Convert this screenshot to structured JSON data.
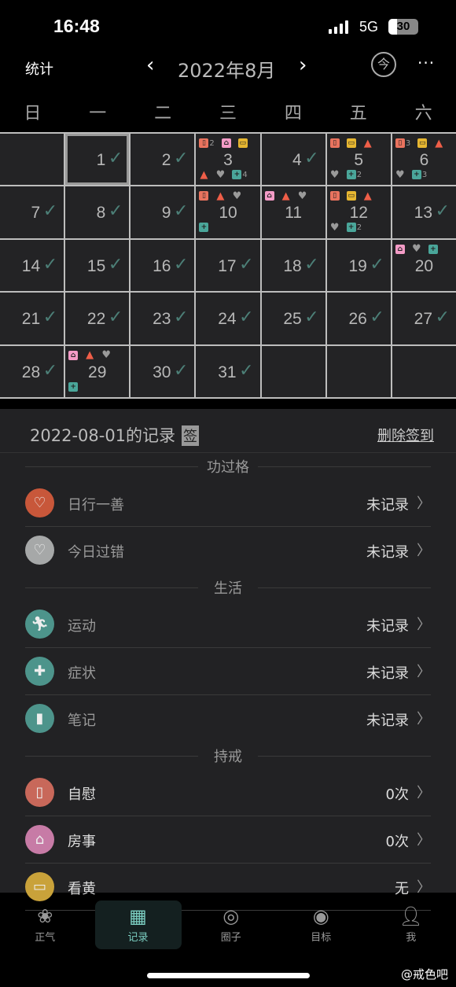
{
  "status": {
    "time": "16:48",
    "network": "5G",
    "battery": "30",
    "battery_level": 30
  },
  "nav": {
    "stats": "统计",
    "prev": "‹",
    "month": "2022年8月",
    "next": "›",
    "today": "今",
    "more": "···"
  },
  "weekdays": [
    "日",
    "一",
    "二",
    "三",
    "四",
    "五",
    "六"
  ],
  "icon_colors": {
    "tissue": "#e9735e",
    "house": "#f39bc6",
    "monitor": "#e6b631",
    "fire": "#ef5e48",
    "heart": "#9a9a9a",
    "medkit": "#4aa69a"
  },
  "calendar": {
    "leading_blank": 1,
    "trailing_blank": 3,
    "selected_day": 1,
    "days": [
      {
        "day": "1",
        "checked": true
      },
      {
        "day": "2",
        "checked": true
      },
      {
        "day": "3",
        "top": [
          {
            "icon": "tissue",
            "count": "2"
          },
          {
            "icon": "house"
          },
          {
            "icon": "monitor"
          }
        ],
        "bottom": [
          {
            "icon": "fire"
          },
          {
            "icon": "heart"
          },
          {
            "icon": "medkit",
            "count": "4"
          }
        ]
      },
      {
        "day": "4",
        "checked": true
      },
      {
        "day": "5",
        "top": [
          {
            "icon": "tissue"
          },
          {
            "icon": "monitor"
          },
          {
            "icon": "fire"
          }
        ],
        "bottom": [
          {
            "icon": "heart"
          },
          {
            "icon": "medkit",
            "count": "2"
          }
        ]
      },
      {
        "day": "6",
        "top": [
          {
            "icon": "tissue",
            "count": "3"
          },
          {
            "icon": "monitor"
          },
          {
            "icon": "fire"
          }
        ],
        "bottom": [
          {
            "icon": "heart"
          },
          {
            "icon": "medkit",
            "count": "3"
          }
        ]
      },
      {
        "day": "7",
        "checked": true
      },
      {
        "day": "8",
        "checked": true
      },
      {
        "day": "9",
        "checked": true
      },
      {
        "day": "10",
        "top": [
          {
            "icon": "tissue"
          },
          {
            "icon": "fire"
          },
          {
            "icon": "heart"
          }
        ],
        "bottom": [
          {
            "icon": "medkit"
          }
        ]
      },
      {
        "day": "11",
        "top": [
          {
            "icon": "house"
          },
          {
            "icon": "fire"
          },
          {
            "icon": "heart"
          }
        ]
      },
      {
        "day": "12",
        "top": [
          {
            "icon": "tissue"
          },
          {
            "icon": "monitor"
          },
          {
            "icon": "fire"
          }
        ],
        "bottom": [
          {
            "icon": "heart"
          },
          {
            "icon": "medkit",
            "count": "2"
          }
        ]
      },
      {
        "day": "13",
        "checked": true
      },
      {
        "day": "14",
        "checked": true
      },
      {
        "day": "15",
        "checked": true
      },
      {
        "day": "16",
        "checked": true
      },
      {
        "day": "17",
        "checked": true
      },
      {
        "day": "18",
        "checked": true
      },
      {
        "day": "19",
        "checked": true
      },
      {
        "day": "20",
        "top": [
          {
            "icon": "house"
          },
          {
            "icon": "heart"
          },
          {
            "icon": "medkit"
          }
        ]
      },
      {
        "day": "21",
        "checked": true
      },
      {
        "day": "22",
        "checked": true
      },
      {
        "day": "23",
        "checked": true
      },
      {
        "day": "24",
        "checked": true
      },
      {
        "day": "25",
        "checked": true
      },
      {
        "day": "26",
        "checked": true
      },
      {
        "day": "27",
        "checked": true
      },
      {
        "day": "28",
        "checked": true
      },
      {
        "day": "29",
        "top": [
          {
            "icon": "house"
          },
          {
            "icon": "fire"
          },
          {
            "icon": "heart"
          }
        ],
        "bottom": [
          {
            "icon": "medkit"
          }
        ]
      },
      {
        "day": "30",
        "checked": true
      },
      {
        "day": "31",
        "checked": true
      }
    ]
  },
  "record": {
    "title": "2022-08-01的记录",
    "sign_badge": "签",
    "delete": "删除签到",
    "sections": [
      {
        "title": "功过格",
        "rows": [
          {
            "label": "日行一善",
            "value": "未记录",
            "icon": "heart-icon",
            "glyph": "♡",
            "color": "#c8573a",
            "label_color": "#999"
          },
          {
            "label": "今日过错",
            "value": "未记录",
            "icon": "broken-heart-icon",
            "glyph": "♡",
            "color": "#a6a8a8",
            "label_color": "#999"
          }
        ]
      },
      {
        "title": "生活",
        "rows": [
          {
            "label": "运动",
            "value": "未记录",
            "icon": "running-icon",
            "glyph": "🏃︎",
            "color": "#4d948b",
            "label_color": "#999"
          },
          {
            "label": "症状",
            "value": "未记录",
            "icon": "medkit-icon",
            "glyph": "✚",
            "color": "#4d948b",
            "label_color": "#999"
          },
          {
            "label": "笔记",
            "value": "未记录",
            "icon": "notebook-icon",
            "glyph": "▮",
            "color": "#4d948b",
            "label_color": "#999"
          }
        ]
      },
      {
        "title": "持戒",
        "rows": [
          {
            "label": "自慰",
            "value": "0次",
            "icon": "tissue-icon",
            "glyph": "▯",
            "color": "#c8685a",
            "label_color": "#ddd"
          },
          {
            "label": "房事",
            "value": "0次",
            "icon": "house-icon",
            "glyph": "⌂",
            "color": "#c77ba6",
            "label_color": "#ddd"
          },
          {
            "label": "看黄",
            "value": "无",
            "icon": "monitor-icon",
            "glyph": "▭",
            "color": "#c9a23a",
            "label_color": "#ddd"
          }
        ]
      }
    ]
  },
  "tabs": [
    {
      "label": "正气",
      "icon": "lotus-icon",
      "glyph": "❀"
    },
    {
      "label": "记录",
      "icon": "calendar-icon",
      "glyph": "▦",
      "active": true
    },
    {
      "label": "圈子",
      "icon": "circle-icon",
      "glyph": "◎"
    },
    {
      "label": "目标",
      "icon": "target-icon",
      "glyph": "◉"
    },
    {
      "label": "我",
      "icon": "person-icon",
      "glyph": "👤︎"
    }
  ],
  "watermark": "@戒色吧"
}
